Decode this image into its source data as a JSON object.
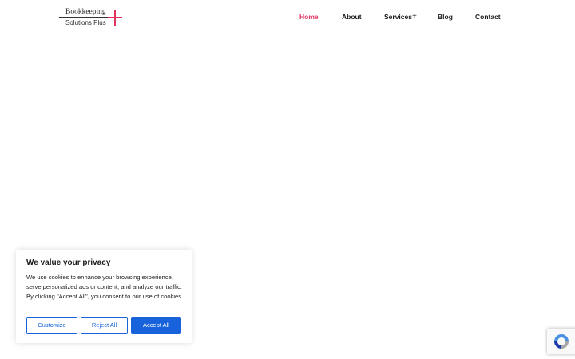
{
  "logo": {
    "line1": "Bookkeeping",
    "line2": "Solutions Plus",
    "accent_color": "#e0335e"
  },
  "nav": {
    "items": [
      {
        "label": "Home",
        "active": true
      },
      {
        "label": "About",
        "active": false
      },
      {
        "label": "Services",
        "active": false,
        "has_submenu": true
      },
      {
        "label": "Blog",
        "active": false
      },
      {
        "label": "Contact",
        "active": false
      }
    ],
    "submenu_icon": "plus-icon",
    "active_color": "#e0335e"
  },
  "cookie_banner": {
    "title": "We value your privacy",
    "body": "We use cookies to enhance your browsing experience, serve personalized ads or content, and analyze our traffic. By clicking \"Accept All\", you consent to our use of cookies.",
    "customize_label": "Customize",
    "reject_label": "Reject All",
    "accept_label": "Accept All",
    "button_color": "#1863dc"
  },
  "recaptcha": {
    "icon": "recaptcha-icon"
  }
}
